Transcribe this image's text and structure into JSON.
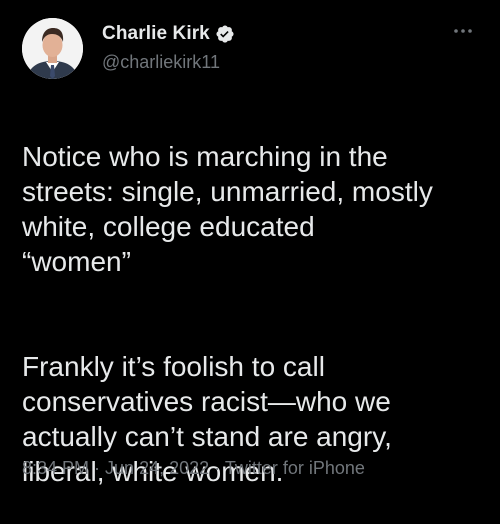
{
  "author": {
    "display_name": "Charlie Kirk",
    "handle": "@charliekirk11",
    "verified": true,
    "avatar_icon": "profile-photo"
  },
  "menu": {
    "icon": "more-horizontal-icon"
  },
  "tweet": {
    "paragraph_1": "Notice who is marching in the\nstreets: single, unmarried, mostly\nwhite, college educated\n“women”",
    "paragraph_2": "Frankly it’s foolish to call\nconservatives racist—who we\nactually can’t stand are angry,\nliberal, white women."
  },
  "meta": {
    "time": "8:34 PM",
    "separator": " · ",
    "date": "Jun 24, 2022",
    "source": "Twitter for iPhone"
  },
  "colors": {
    "background": "#000000",
    "text_primary": "#e7e9ea",
    "text_secondary": "#71767b",
    "verified_badge": "#e7e9ea"
  }
}
